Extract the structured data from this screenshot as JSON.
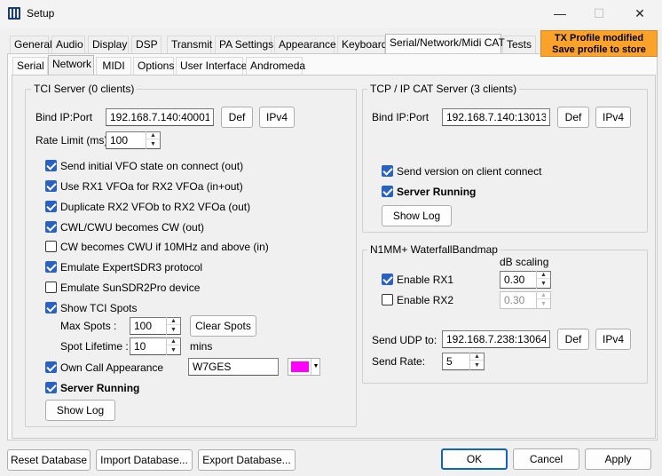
{
  "window": {
    "title": "Setup",
    "minimize_glyph": "—",
    "maximize_glyph": "☐",
    "close_glyph": "✕"
  },
  "main_tabs": [
    {
      "label": "General"
    },
    {
      "label": "Audio"
    },
    {
      "label": "Display"
    },
    {
      "label": "DSP"
    },
    {
      "label": "Transmit"
    },
    {
      "label": "PA Settings"
    },
    {
      "label": "Appearance"
    },
    {
      "label": "Keyboard"
    },
    {
      "label": "Serial/Network/Midi CAT"
    },
    {
      "label": "Tests"
    }
  ],
  "tx_banner": {
    "line1": "TX Profile modified",
    "line2": "Save profile to store",
    "color": "#fba22a"
  },
  "sub_tabs": [
    {
      "label": "Serial"
    },
    {
      "label": "Network"
    },
    {
      "label": "MIDI"
    },
    {
      "label": "Options"
    },
    {
      "label": "User Interface"
    },
    {
      "label": "Andromeda"
    }
  ],
  "tci": {
    "group_title": "TCI Server (0 clients)",
    "bind_label": "Bind IP:Port",
    "bind_value": "192.168.7.140:40001",
    "def_label": "Def",
    "ipv4_label": "IPv4",
    "rate_label": "Rate Limit (ms)",
    "rate_value": "100",
    "options": [
      {
        "label": "Send initial VFO state on connect (out)",
        "checked": true
      },
      {
        "label": "Use RX1 VFOa for RX2 VFOa (in+out)",
        "checked": true
      },
      {
        "label": "Duplicate RX2 VFOb to RX2 VFOa (out)",
        "checked": true
      },
      {
        "label": "CWL/CWU becomes CW (out)",
        "checked": true
      },
      {
        "label": "CW becomes CWU if 10MHz and above (in)",
        "checked": false
      },
      {
        "label": "Emulate ExpertSDR3 protocol",
        "checked": true
      },
      {
        "label": "Emulate SunSDR2Pro device",
        "checked": false
      },
      {
        "label": "Show TCI Spots",
        "checked": true
      }
    ],
    "max_spots_label": "Max Spots :",
    "max_spots_value": "100",
    "clear_spots_label": "Clear Spots",
    "spot_lifetime_label": "Spot Lifetime :",
    "spot_lifetime_value": "10",
    "mins_label": "mins",
    "own_call_label": "Own Call Appearance",
    "own_call_checked": true,
    "own_call_value": "W7GES",
    "own_call_color": "#ff00ff",
    "server_running_label": "Server Running",
    "server_running_checked": true,
    "show_log_label": "Show Log"
  },
  "tcpip": {
    "group_title": "TCP / IP CAT Server (3 clients)",
    "bind_label": "Bind IP:Port",
    "bind_value": "192.168.7.140:13013",
    "def_label": "Def",
    "ipv4_label": "IPv4",
    "send_version_label": "Send version on client connect",
    "send_version_checked": true,
    "server_running_label": "Server Running",
    "server_running_checked": true,
    "show_log_label": "Show Log"
  },
  "n1mm": {
    "group_title": "N1MM+ WaterfallBandmap",
    "db_scaling_label": "dB scaling",
    "rx1_label": "Enable RX1",
    "rx1_checked": true,
    "rx1_value": "0.30",
    "rx2_label": "Enable RX2",
    "rx2_checked": false,
    "rx2_value": "0.30",
    "udp_label": "Send UDP to:",
    "udp_value": "192.168.7.238:13064",
    "def_label": "Def",
    "ipv4_label": "IPv4",
    "send_rate_label": "Send Rate:",
    "send_rate_value": "5"
  },
  "footer": {
    "reset_label": "Reset Database",
    "import_label": "Import Database...",
    "export_label": "Export Database...",
    "ok_label": "OK",
    "cancel_label": "Cancel",
    "apply_label": "Apply"
  }
}
